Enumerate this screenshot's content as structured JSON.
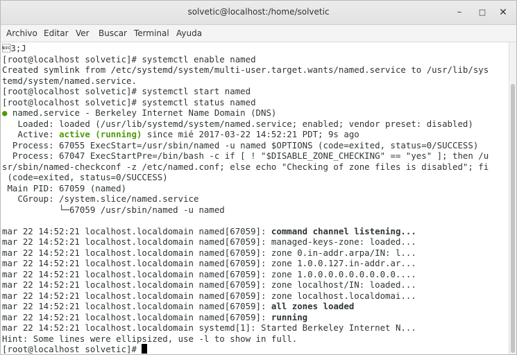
{
  "window": {
    "title": "solvetic@localhost:/home/solvetic",
    "controls": {
      "minimize": "–",
      "maximize": "□",
      "close": "✕"
    }
  },
  "menu": [
    "Archivo",
    "Editar",
    "Ver",
    "Buscar",
    "Terminal",
    "Ayuda"
  ],
  "terminal": {
    "lines": [
      "\u001b3;J",
      "[root@localhost solvetic]# systemctl enable named",
      "Created symlink from /etc/systemd/system/multi-user.target.wants/named.service to /usr/lib/sys",
      "temd/system/named.service.",
      "[root@localhost solvetic]# systemctl start named",
      "[root@localhost solvetic]# systemctl status named",
      " named.service - Berkeley Internet Name Domain (DNS)",
      "   Loaded: loaded (/usr/lib/systemd/system/named.service; enabled; vendor preset: disabled)",
      "   Active: active (running) since mié 2017-03-22 14:52:21 PDT; 9s ago",
      "  Process: 67055 ExecStart=/usr/sbin/named -u named $OPTIONS (code=exited, status=0/SUCCESS)",
      "  Process: 67047 ExecStartPre=/bin/bash -c if [ ! \"$DISABLE_ZONE_CHECKING\" == \"yes\" ]; then /u",
      "sr/sbin/named-checkconf -z /etc/named.conf; else echo \"Checking of zone files is disabled\"; fi",
      " (code=exited, status=0/SUCCESS)",
      " Main PID: 67059 (named)",
      "   CGroup: /system.slice/named.service",
      "           └─67059 /usr/sbin/named -u named",
      "",
      "mar 22 14:52:21 localhost.localdomain named[67059]: command channel listening...",
      "mar 22 14:52:21 localhost.localdomain named[67059]: managed-keys-zone: loaded...",
      "mar 22 14:52:21 localhost.localdomain named[67059]: zone 0.in-addr.arpa/IN: l...",
      "mar 22 14:52:21 localhost.localdomain named[67059]: zone 1.0.0.127.in-addr.ar...",
      "mar 22 14:52:21 localhost.localdomain named[67059]: zone 1.0.0.0.0.0.0.0.0.0....",
      "mar 22 14:52:21 localhost.localdomain named[67059]: zone localhost/IN: loaded...",
      "mar 22 14:52:21 localhost.localdomain named[67059]: zone localhost.localdomai...",
      "mar 22 14:52:21 localhost.localdomain named[67059]: all zones loaded",
      "mar 22 14:52:21 localhost.localdomain named[67059]: running",
      "mar 22 14:52:21 localhost.localdomain systemd[1]: Started Berkeley Internet N...",
      "Hint: Some lines were ellipsized, use -l to show in full.",
      "[root@localhost solvetic]# "
    ],
    "active_prefix": "   Active: ",
    "active_status": "active (running)",
    "active_suffix": " since mié 2017-03-22 14:52:21 PDT; 9s ago",
    "status_dot": "●",
    "bold_log_prefix": "mar 22 14:52:21 localhost.localdomain named[67059]: ",
    "bold_messages": [
      "command channel listening...",
      "all zones loaded",
      "running"
    ],
    "colors": {
      "text": "#2e3436",
      "active_green": "#4e9a06",
      "background": "#ffffff"
    }
  }
}
